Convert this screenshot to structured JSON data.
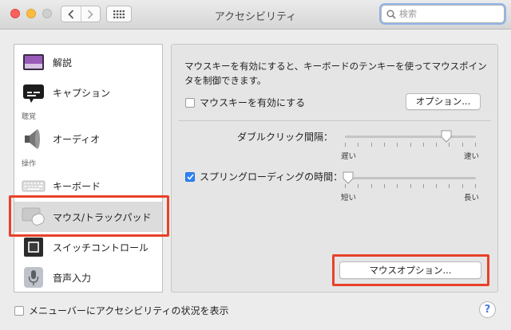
{
  "window": {
    "title": "アクセシビリティ"
  },
  "toolbar": {
    "search_placeholder": "検索"
  },
  "sidebar": {
    "items": [
      {
        "label": "解説",
        "icon": "description-icon"
      },
      {
        "label": "キャプション",
        "icon": "captions-icon"
      },
      {
        "category": "聴覚"
      },
      {
        "label": "オーディオ",
        "icon": "speaker-icon"
      },
      {
        "category": "操作"
      },
      {
        "label": "キーボード",
        "icon": "keyboard-icon"
      },
      {
        "label": "マウス/トラックパッド",
        "icon": "mouse-trackpad-icon",
        "selected": true
      },
      {
        "label": "スイッチコントロール",
        "icon": "switch-control-icon"
      },
      {
        "label": "音声入力",
        "icon": "microphone-icon"
      }
    ]
  },
  "main": {
    "description": "マウスキーを有効にすると、キーボードのテンキーを使ってマウスポインタを制御できます。",
    "mouse_keys_checkbox": {
      "label": "マウスキーを有効にする",
      "checked": false
    },
    "mouse_keys_options_button": "オプション...",
    "double_click": {
      "label": "ダブルクリック間隔：",
      "min_label": "遅い",
      "max_label": "速い",
      "value": 0.78
    },
    "spring_loading": {
      "label": "スプリングローディングの時間：",
      "checked": true,
      "min_label": "短い",
      "max_label": "長い",
      "value": 0.03
    },
    "mouse_options_button": "マウスオプション..."
  },
  "footer": {
    "menubar_checkbox": {
      "label": "メニューバーにアクセシビリティの状況を表示",
      "checked": false
    }
  },
  "colors": {
    "highlight_box": "#e8412a",
    "checkbox_on": "#2f81f7",
    "search_focus": "#8fb4e8"
  }
}
